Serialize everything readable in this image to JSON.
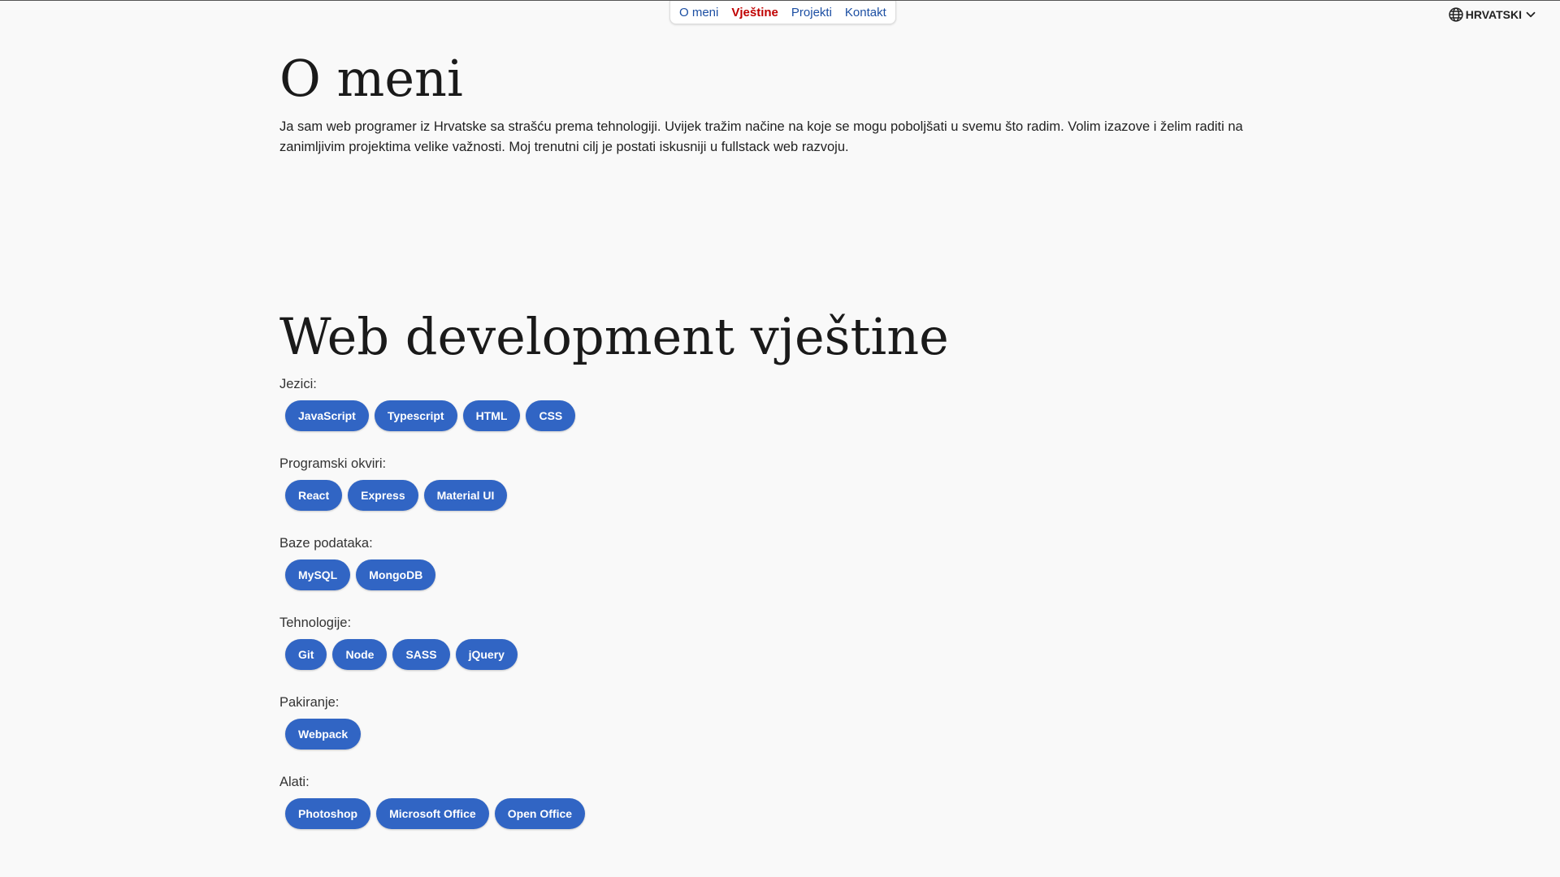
{
  "nav": {
    "items": [
      {
        "label": "O meni",
        "active": false
      },
      {
        "label": "Vještine",
        "active": true
      },
      {
        "label": "Projekti",
        "active": false
      },
      {
        "label": "Kontakt",
        "active": false
      }
    ],
    "link_color": "#1c4fa3",
    "active_color": "#c00000"
  },
  "language": {
    "label": "HRVATSKI",
    "icon": "globe-icon",
    "dropdown_icon": "chevron-down-icon"
  },
  "about": {
    "title": "O meni",
    "text": "Ja sam web programer iz Hrvatske sa strašću prema tehnologiji. Uvijek tražim načine na koje se mogu poboljšati u svemu što radim. Volim izazove i želim raditi na zanimljivim projektima velike važnosti. Moj trenutni cilj je postati iskusniji u fullstack web razvoju."
  },
  "skills": {
    "title": "Web development vještine",
    "chip_color": "#3165c4",
    "groups": [
      {
        "label": "Jezici:",
        "items": [
          "JavaScript",
          "Typescript",
          "HTML",
          "CSS"
        ]
      },
      {
        "label": "Programski okviri:",
        "items": [
          "React",
          "Express",
          "Material UI"
        ]
      },
      {
        "label": "Baze podataka:",
        "items": [
          "MySQL",
          "MongoDB"
        ]
      },
      {
        "label": "Tehnologije:",
        "items": [
          "Git",
          "Node",
          "SASS",
          "jQuery"
        ]
      },
      {
        "label": "Pakiranje:",
        "items": [
          "Webpack"
        ]
      },
      {
        "label": "Alati:",
        "items": [
          "Photoshop",
          "Microsoft Office",
          "Open Office"
        ]
      }
    ]
  }
}
